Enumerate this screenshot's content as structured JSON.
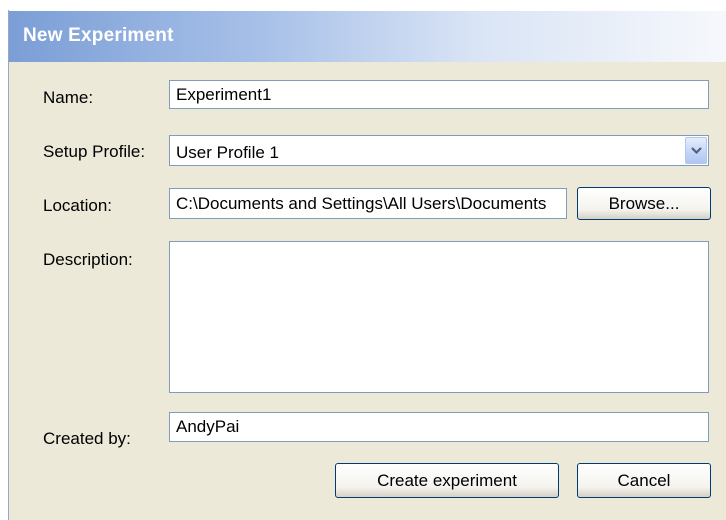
{
  "window": {
    "title": "New Experiment"
  },
  "form": {
    "name_label": "Name:",
    "name_value": "Experiment1",
    "setup_profile_label": "Setup Profile:",
    "setup_profile_value": "User Profile 1",
    "location_label": "Location:",
    "location_value": "C:\\Documents and Settings\\All Users\\Documents",
    "browse_label": "Browse...",
    "description_label": "Description:",
    "description_value": "",
    "created_by_label": "Created by:",
    "created_by_value": "AndyPai"
  },
  "actions": {
    "create_label": "Create experiment",
    "cancel_label": "Cancel"
  },
  "icons": {
    "dropdown": "chevron-down-icon"
  }
}
